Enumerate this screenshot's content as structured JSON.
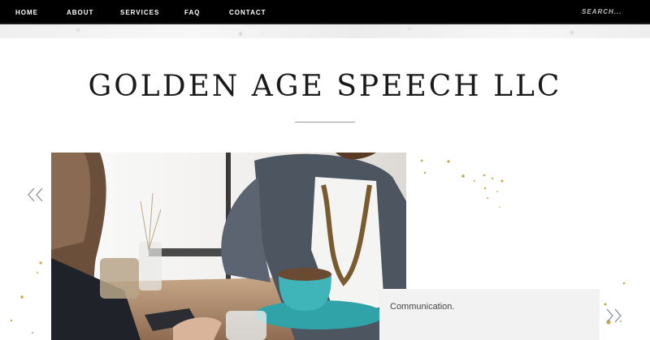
{
  "nav": {
    "links": [
      "HOME",
      "ABOUT",
      "SERVICES",
      "FAQ",
      "CONTACT"
    ],
    "search_placeholder": "SEARCH..."
  },
  "header": {
    "title": "GOLDEN AGE SPEECH LLC"
  },
  "slideshow": {
    "prev_icon": "double-chevron-left",
    "next_icon": "double-chevron-right",
    "caption": "Communication."
  },
  "colors": {
    "nav_bg": "#000000",
    "nav_text": "#ffffff",
    "accent_gold": "#c9a64b",
    "caption_bg": "#f2f2f2",
    "arrow": "#8a8f96"
  }
}
